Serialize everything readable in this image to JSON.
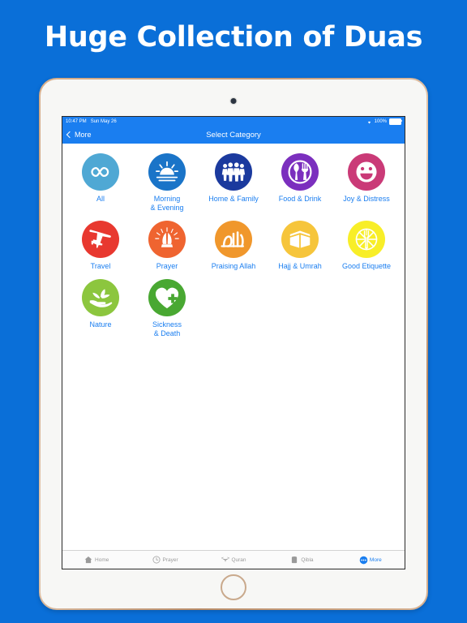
{
  "promo": {
    "headline": "Huge Collection of Duas"
  },
  "device": {
    "camera_icon": "camera-dot",
    "home_button": "home-button"
  },
  "status_bar": {
    "time": "10:47 PM",
    "date": "Sun May 26",
    "wifi_icon": "wifi-icon",
    "battery_percent": "100%",
    "battery_icon": "battery-icon"
  },
  "nav_bar": {
    "back_label": "More",
    "back_icon": "chevron-left-icon",
    "title": "Select Category"
  },
  "categories": [
    {
      "label": "All",
      "icon": "infinity-icon",
      "color": "#4fa8d4"
    },
    {
      "label": "Morning\n& Evening",
      "icon": "sunrise-icon",
      "color": "#1a74c8"
    },
    {
      "label": "Home & Family",
      "icon": "family-icon",
      "color": "#1b3a9e"
    },
    {
      "label": "Food & Drink",
      "icon": "cutlery-icon",
      "color": "#7b2fbe"
    },
    {
      "label": "Joy & Distress",
      "icon": "smiley-icon",
      "color": "#ca3a77"
    },
    {
      "label": "Travel",
      "icon": "airplane-icon",
      "color": "#e8382f"
    },
    {
      "label": "Prayer",
      "icon": "praying-hands-icon",
      "color": "#ef6430"
    },
    {
      "label": "Praising Allah",
      "icon": "allah-calligraphy-icon",
      "color": "#f0972c"
    },
    {
      "label": "Hajj & Umrah",
      "icon": "kaaba-icon",
      "color": "#f6c53b"
    },
    {
      "label": "Good Etiquette",
      "icon": "fork-plate-icon",
      "color": "#f8ee28"
    },
    {
      "label": "Nature",
      "icon": "plant-hand-icon",
      "color": "#8cc63e"
    },
    {
      "label": "Sickness\n& Death",
      "icon": "heart-cross-icon",
      "color": "#49a832"
    }
  ],
  "tab_bar": {
    "items": [
      {
        "label": "Home",
        "icon": "house-icon",
        "active": false
      },
      {
        "label": "Prayer",
        "icon": "clock-icon",
        "active": false
      },
      {
        "label": "Quran",
        "icon": "quran-icon",
        "active": false
      },
      {
        "label": "Qibla",
        "icon": "compass-icon",
        "active": false
      },
      {
        "label": "More",
        "icon": "more-dots-icon",
        "active": true
      }
    ]
  },
  "colors": {
    "background": "#0a6fd8",
    "ios_blue": "#1a7ef0",
    "label_blue": "#1a7ef0"
  }
}
